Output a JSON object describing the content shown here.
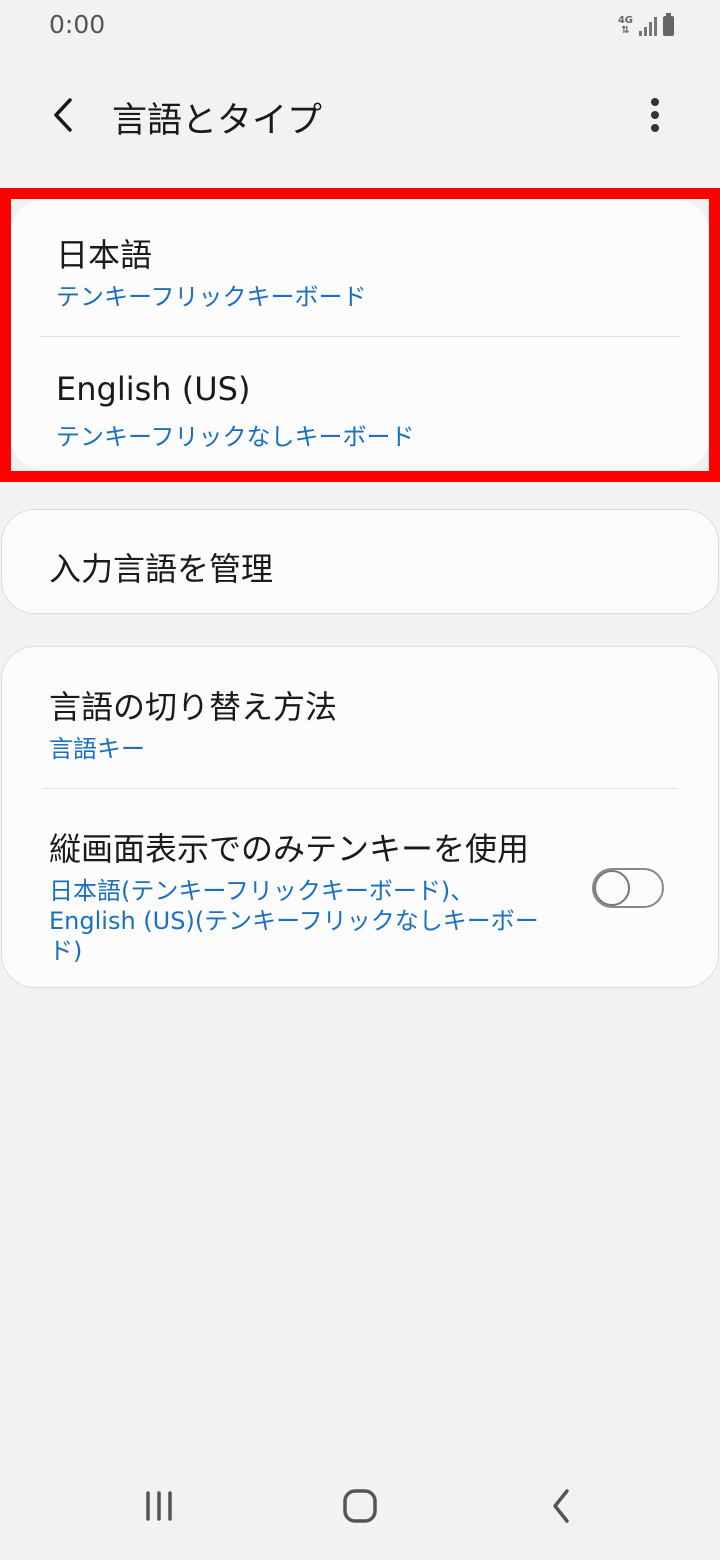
{
  "status_bar": {
    "time": "0:00",
    "network": "4G"
  },
  "app_bar": {
    "title": "言語とタイプ",
    "back_icon": "chevron-left-icon",
    "more_icon": "more-vertical-icon"
  },
  "keyboards": [
    {
      "title": "日本語",
      "subtitle": "テンキーフリックキーボード"
    },
    {
      "title": "English (US)",
      "subtitle": "テンキーフリックなしキーボード"
    }
  ],
  "manage": {
    "title": "入力言語を管理"
  },
  "switch_method": {
    "title": "言語の切り替え方法",
    "subtitle": "言語キー"
  },
  "portrait_tenkey": {
    "title": "縦画面表示でのみテンキーを使用",
    "subtitle_line1": "日本語(テンキーフリックキーボード)、",
    "subtitle_line2": "English (US)(テンキーフリックなしキーボー",
    "subtitle_line3": "ド)",
    "toggle_on": false
  },
  "colors": {
    "accent": "#1a6fc2",
    "highlight": "#ff0000",
    "background": "#f2f2f2"
  },
  "nav_bar": {
    "recents_icon": "recents-icon",
    "home_icon": "home-icon",
    "back_icon": "back-icon"
  }
}
